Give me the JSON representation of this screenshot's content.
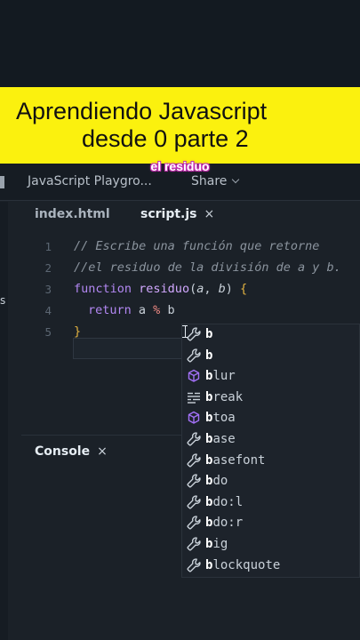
{
  "banner": {
    "line1": "Aprendiendo Javascript",
    "line2": "desde 0 parte 2"
  },
  "caption": "el residuo",
  "titlebar": {
    "title": "JavaScript Playgro...",
    "share": "Share"
  },
  "tabs": [
    {
      "label": "index.html"
    },
    {
      "label": "script.js",
      "close": "×"
    }
  ],
  "editor": {
    "line_numbers": [
      "1",
      "2",
      "3",
      "4",
      "5"
    ],
    "lines": {
      "l1": "// Escribe una función que retorne",
      "l2": "//el residuo de la división de a y b.",
      "l3_kw": "function",
      "l3_name": "residuo",
      "l3_open": "(",
      "l3_a": "a",
      "l3_sep": ", ",
      "l3_b": "b",
      "l3_close": ") ",
      "l3_brace": "{",
      "l4_kw": "return",
      "l4_a": " a ",
      "l4_op": "%",
      "l4_b": " b",
      "l5_brace": "}"
    }
  },
  "console": {
    "label": "Console",
    "close": "×"
  },
  "suggestions": [
    {
      "match": "b",
      "rest": "",
      "icon": "wrench-icon"
    },
    {
      "match": "b",
      "rest": "",
      "icon": "wrench-icon"
    },
    {
      "match": "b",
      "rest": "lur",
      "icon": "method-cube-icon"
    },
    {
      "match": "b",
      "rest": "reak",
      "icon": "keyword-icon"
    },
    {
      "match": "b",
      "rest": "toa",
      "icon": "method-cube-icon"
    },
    {
      "match": "b",
      "rest": "ase",
      "icon": "wrench-icon"
    },
    {
      "match": "b",
      "rest": "asefont",
      "icon": "wrench-icon"
    },
    {
      "match": "b",
      "rest": "do",
      "icon": "wrench-icon"
    },
    {
      "match": "b",
      "rest": "do:l",
      "icon": "wrench-icon"
    },
    {
      "match": "b",
      "rest": "do:r",
      "icon": "wrench-icon"
    },
    {
      "match": "b",
      "rest": "ig",
      "icon": "wrench-icon"
    },
    {
      "match": "b",
      "rest": "lockquote",
      "icon": "wrench-icon"
    }
  ],
  "colors": {
    "banner_yellow": "#fbf10e",
    "caption_outline": "#c42fb0",
    "method_purple": "#a371f7"
  }
}
